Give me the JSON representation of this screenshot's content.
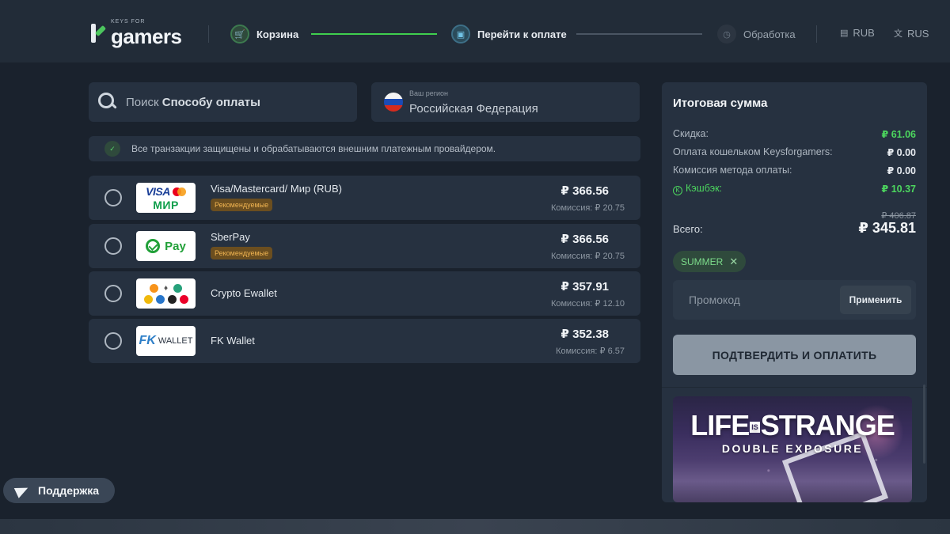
{
  "header": {
    "logo_small": "KEYS FOR",
    "logo_big": "gamers",
    "steps": [
      {
        "label": "Корзина",
        "state": "done",
        "icon": "cart-icon"
      },
      {
        "label": "Перейти к оплате",
        "state": "active",
        "icon": "card-icon"
      },
      {
        "label": "Обработка",
        "state": "pending",
        "icon": "clock-icon"
      }
    ],
    "currency": "RUB",
    "language": "RUS"
  },
  "search": {
    "placeholder_prefix": "Поиск",
    "placeholder_bold": "Способу оплаты"
  },
  "region": {
    "caption": "Ваш регион",
    "value": "Российская Федерация"
  },
  "notice": "Все транзакции защищены и обрабатываются внешним платежным провайдером.",
  "payment_methods": [
    {
      "name": "Visa/Mastercard/ Мир (RUB)",
      "badge": "Рекомендуемые",
      "price": "₽ 366.56",
      "fee": "Комиссия: ₽ 20.75",
      "logo": {
        "top": "VISA",
        "bottom": "МИР"
      }
    },
    {
      "name": "SberPay",
      "badge": "Рекомендуемые",
      "price": "₽ 366.56",
      "fee": "Комиссия: ₽ 20.75",
      "logo": {
        "text": "Pay"
      }
    },
    {
      "name": "Crypto Ewallet",
      "badge": "",
      "price": "₽ 357.91",
      "fee": "Комиссия: ₽ 12.10",
      "logo": {
        "text": ""
      }
    },
    {
      "name": "FK Wallet",
      "badge": "",
      "price": "₽ 352.38",
      "fee": "Комиссия: ₽ 6.57",
      "logo": {
        "mark": "FK",
        "text": "WALLET"
      }
    }
  ],
  "summary": {
    "title": "Итоговая сумма",
    "rows": [
      {
        "label": "Скидка:",
        "value": "₽ 61.06"
      },
      {
        "label": "Оплата кошельком Keysforgamers:",
        "value": "₽ 0.00"
      },
      {
        "label": "Комиссия метода оплаты:",
        "value": "₽ 0.00"
      },
      {
        "label": "Кэшбэк:",
        "value": "₽ 10.37"
      }
    ],
    "old_total": "₽ 406.87",
    "total_label": "Всего:",
    "total_value": "₽ 345.81",
    "promo_code": "SUMMER",
    "promo_placeholder": "Промокод",
    "apply_label": "Применить",
    "pay_label": "ПОДТВЕРДИТЬ И ОПЛАТИТЬ"
  },
  "game": {
    "title_left": "LIFE",
    "title_is": "IS",
    "title_right": "STRANGE",
    "subtitle": "DOUBLE EXPOSURE"
  },
  "support_label": "Поддержка",
  "colors": {
    "accent_green": "#4cd65e",
    "badge_bg": "#6b4e1f",
    "panel": "#263140",
    "background": "#1a222d"
  }
}
